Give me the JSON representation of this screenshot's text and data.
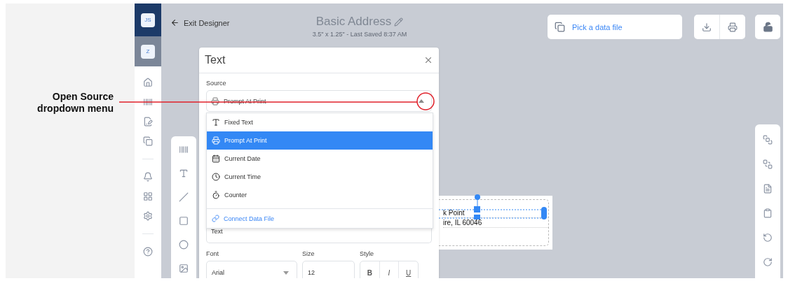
{
  "callout": {
    "text": "Open Source dropdown menu"
  },
  "nav": {
    "avatars": [
      {
        "initials": "JS",
        "selected": true
      },
      {
        "initials": "Z",
        "selected": false
      }
    ]
  },
  "header": {
    "back_link": "Exit Designer",
    "title": "Basic Address",
    "subtitle": "3.5\" x 1.25\" - Last Saved 8:37 AM",
    "data_file_button": "Pick a data file"
  },
  "dialog": {
    "title": "Text",
    "source_label": "Source",
    "source_value": "Prompt At Print",
    "source_options": [
      {
        "label": "Fixed Text",
        "kind": "text",
        "selected": false
      },
      {
        "label": "Prompt At Print",
        "kind": "print",
        "selected": true
      },
      {
        "label": "Current Date",
        "kind": "date",
        "selected": false
      },
      {
        "label": "Current Time",
        "kind": "time",
        "selected": false
      },
      {
        "label": "Counter",
        "kind": "counter",
        "selected": false
      }
    ],
    "connect_link": "Connect Data File",
    "text_value": "Text",
    "font_label": "Font",
    "font_value": "Arial",
    "size_label": "Size",
    "size_value": "12",
    "style_label": "Style",
    "style_buttons": [
      {
        "label": "B",
        "kind": "bold"
      },
      {
        "label": "I",
        "kind": "italic"
      },
      {
        "label": "U",
        "kind": "underline"
      }
    ]
  },
  "label_preview": {
    "lines": [
      "k Point",
      "ire, IL 60046"
    ]
  }
}
